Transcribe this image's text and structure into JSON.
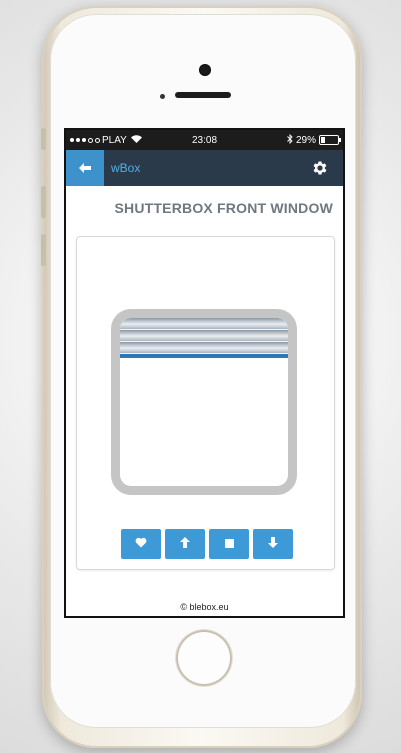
{
  "status_bar": {
    "carrier": "PLAY",
    "time": "23:08",
    "battery": "29%",
    "battery_level": 0.29
  },
  "nav": {
    "app_title": "wBox",
    "back_icon": "arrow-left-icon",
    "settings_icon": "gear-icon"
  },
  "device": {
    "title": "SHUTTERBOX FRONT WINDOW",
    "shutter_position": 0.3
  },
  "controls": [
    {
      "name": "favorite-button",
      "icon": "heart-icon"
    },
    {
      "name": "up-button",
      "icon": "arrow-up-icon"
    },
    {
      "name": "stop-button",
      "icon": "stop-icon"
    },
    {
      "name": "down-button",
      "icon": "arrow-down-icon"
    }
  ],
  "footer": {
    "text": "© blebox.eu"
  },
  "colors": {
    "accent": "#3e9ad6",
    "nav_bg": "#2a3a4a",
    "title_link": "#4fb0ea",
    "rail": "#2d77b6"
  }
}
